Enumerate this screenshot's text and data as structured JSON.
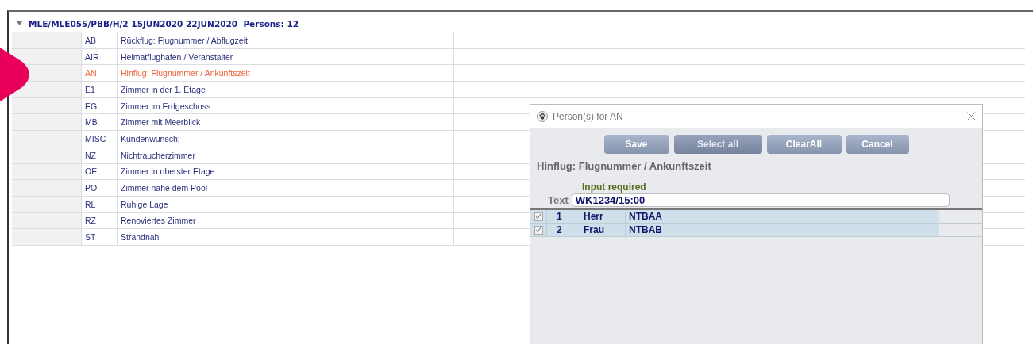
{
  "group": {
    "expanded": true,
    "title": "MLE/MLE055/PBB/H/2 15JUN2020 22JUN2020  Persons: 12"
  },
  "rows": [
    {
      "code": "AB",
      "description": "Rückflug: Flugnummer / Abflugzeit",
      "selected": false
    },
    {
      "code": "AIR",
      "description": "Heimatflughafen / Veranstalter",
      "selected": false
    },
    {
      "code": "AN",
      "description": "Hinflug: Flugnummer / Ankunftszeit",
      "selected": true
    },
    {
      "code": "E1",
      "description": "Zimmer in der 1. Etage",
      "selected": false
    },
    {
      "code": "EG",
      "description": "Zimmer im Erdgeschoss",
      "selected": false
    },
    {
      "code": "MB",
      "description": "Zimmer mit Meerblick",
      "selected": false
    },
    {
      "code": "MISC",
      "description": "Kundenwunsch:",
      "selected": false
    },
    {
      "code": "NZ",
      "description": "Nichtraucherzimmer",
      "selected": false
    },
    {
      "code": "OE",
      "description": "Zimmer in oberster Etage",
      "selected": false
    },
    {
      "code": "PO",
      "description": "Zimmer nahe dem Pool",
      "selected": false
    },
    {
      "code": "RL",
      "description": "Ruhige Lage",
      "selected": false
    },
    {
      "code": "RZ",
      "description": "Renoviertes Zimmer",
      "selected": false
    },
    {
      "code": "ST",
      "description": "Strandnah",
      "selected": false
    }
  ],
  "dialog": {
    "title": "Person(s) for AN",
    "buttons": [
      {
        "label": "Save",
        "disabled": false
      },
      {
        "label": "Select all",
        "disabled": true
      },
      {
        "label": "ClearAll",
        "disabled": false
      },
      {
        "label": "Cancel",
        "disabled": false
      }
    ],
    "heading": "Hinflug: Flugnummer / Ankunftszeit",
    "hint": "Input required",
    "field": {
      "label": "Text",
      "value": "WK1234/15:00"
    },
    "persons": [
      {
        "checked": true,
        "number": "1",
        "title": "Herr",
        "name": "NTBAA"
      },
      {
        "checked": true,
        "number": "2",
        "title": "Frau",
        "name": "NTBAB"
      }
    ]
  }
}
